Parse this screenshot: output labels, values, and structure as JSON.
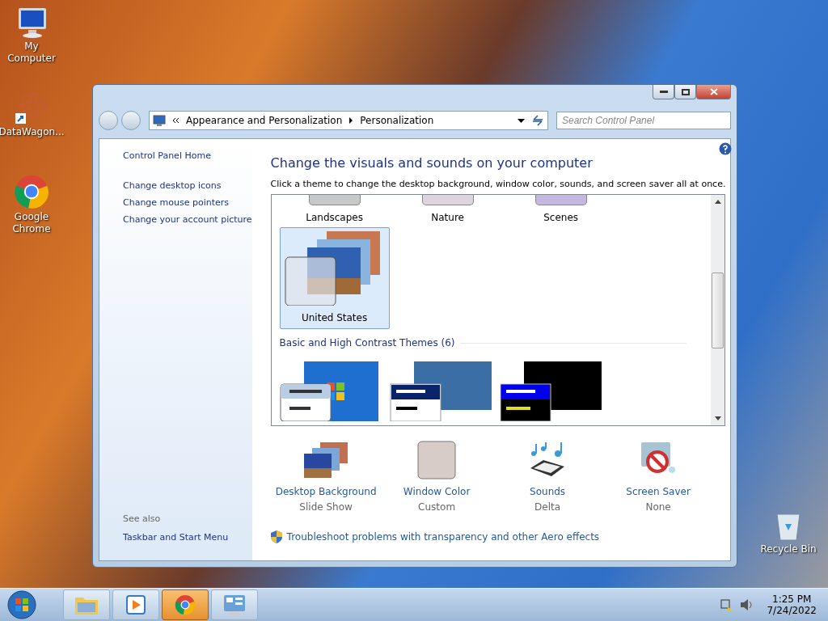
{
  "desktop_icons": [
    {
      "label": "My Computer",
      "kind": "computer"
    },
    {
      "label": "DataWagon...",
      "kind": "shortcut"
    },
    {
      "label": "Google Chrome",
      "kind": "chrome"
    }
  ],
  "recycle_bin": {
    "label": "Recycle Bin"
  },
  "window": {
    "breadcrumb": [
      "Appearance and Personalization",
      "Personalization"
    ],
    "search": {
      "placeholder": "Search Control Panel"
    },
    "sidebar": {
      "links": [
        "Control Panel Home",
        "Change desktop icons",
        "Change mouse pointers",
        "Change your account picture"
      ],
      "see_also_title": "See also",
      "see_also_links": [
        "Taskbar and Start Menu"
      ]
    },
    "title": "Change the visuals and sounds on your computer",
    "subtitle": "Click a theme to change the desktop background, window color, sounds, and screen saver all at once.",
    "cut_themes": [
      {
        "label": "Landscapes",
        "color": "#c8c8c8"
      },
      {
        "label": "Nature",
        "color": "#ddd4e0"
      },
      {
        "label": "Scenes",
        "color": "#c4b8e0"
      }
    ],
    "themes": [
      {
        "label": "United States",
        "selected": true
      }
    ],
    "section_title": "Basic and High Contrast Themes (6)",
    "basic_themes": [
      {
        "kind": "aero-basic"
      },
      {
        "kind": "classic"
      },
      {
        "kind": "high-contrast"
      }
    ],
    "settings": [
      {
        "label": "Desktop Background",
        "value": "Slide Show",
        "kind": "background"
      },
      {
        "label": "Window Color",
        "value": "Custom",
        "kind": "color"
      },
      {
        "label": "Sounds",
        "value": "Delta",
        "kind": "sounds"
      },
      {
        "label": "Screen Saver",
        "value": "None",
        "kind": "saver"
      }
    ],
    "troubleshoot": "Troubleshoot problems with transparency and other Aero effects"
  },
  "taskbar": {
    "apps": [
      {
        "kind": "explorer",
        "selected": false
      },
      {
        "kind": "media",
        "selected": false
      },
      {
        "kind": "chrome",
        "selected": true
      },
      {
        "kind": "control-panel",
        "selected": false
      }
    ],
    "time": "1:25 PM",
    "date": "7/24/2022"
  }
}
